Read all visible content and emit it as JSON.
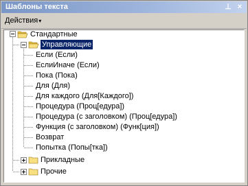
{
  "window": {
    "title": "Шаблоны текста",
    "pin_icon": "pin-icon",
    "close_icon": "close-icon",
    "pin_glyph": "⊥",
    "close_glyph": "×"
  },
  "toolbar": {
    "actions_label": "Действия",
    "actions_caret": "▾"
  },
  "tree": {
    "root": {
      "label": "Стандартные"
    },
    "control": {
      "label": "Управляющие"
    },
    "items": [
      {
        "label": "Если (Если)"
      },
      {
        "label": "ЕслиИначе (Если)"
      },
      {
        "label": "Пока (Пока)"
      },
      {
        "label": "Для (Для)"
      },
      {
        "label": "Для каждого (Для[Каждого])"
      },
      {
        "label": "Процедура (Проц[едура])"
      },
      {
        "label": "Процедура (с заголовком) (Проц[едура])"
      },
      {
        "label": "Функция (с заголовком) (Функ[ция])"
      },
      {
        "label": "Возврат"
      },
      {
        "label": "Попытка (Попы[тка])"
      }
    ],
    "applied": {
      "label": "Прикладные"
    },
    "other": {
      "label": "Прочие"
    }
  },
  "colors": {
    "selection": "#0a246a",
    "folder": "#f0d060"
  }
}
